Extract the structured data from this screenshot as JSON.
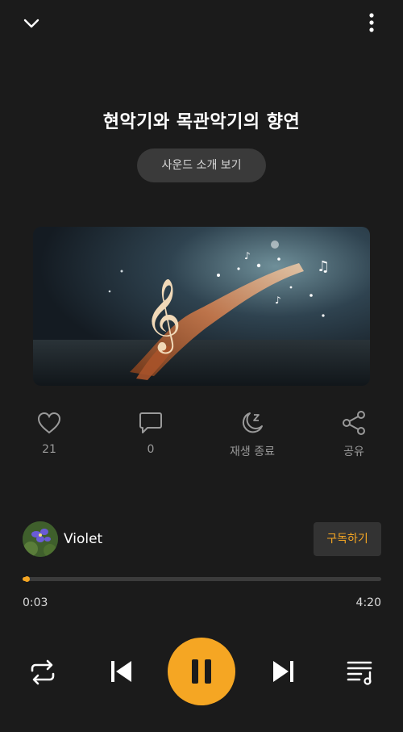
{
  "header": {
    "title": "현악기와 목관악기의 향연",
    "sound_intro_label": "사운드 소개 보기"
  },
  "actions": {
    "like_count": "21",
    "comment_count": "0",
    "sleep_timer_label": "재생 종료",
    "share_label": "공유"
  },
  "creator": {
    "name": "Violet",
    "subscribe_label": "구독하기"
  },
  "player": {
    "current_time": "0:03",
    "total_time": "4:20",
    "progress": 0.012,
    "state": "playing"
  },
  "icons": {
    "top_left": "chevron-down-icon",
    "top_right": "more-vertical-icon",
    "like": "heart-icon",
    "comment": "comment-icon",
    "sleep": "moon-zz-icon",
    "share": "share-icon",
    "repeat": "repeat-icon",
    "prev": "skip-previous-icon",
    "pause": "pause-icon",
    "next": "skip-next-icon",
    "playlist": "playlist-icon"
  },
  "colors": {
    "background": "#1b1b1b",
    "accent": "#f5a623",
    "muted_text": "#9a9a9a",
    "chip_bg": "#3a3a3a"
  }
}
